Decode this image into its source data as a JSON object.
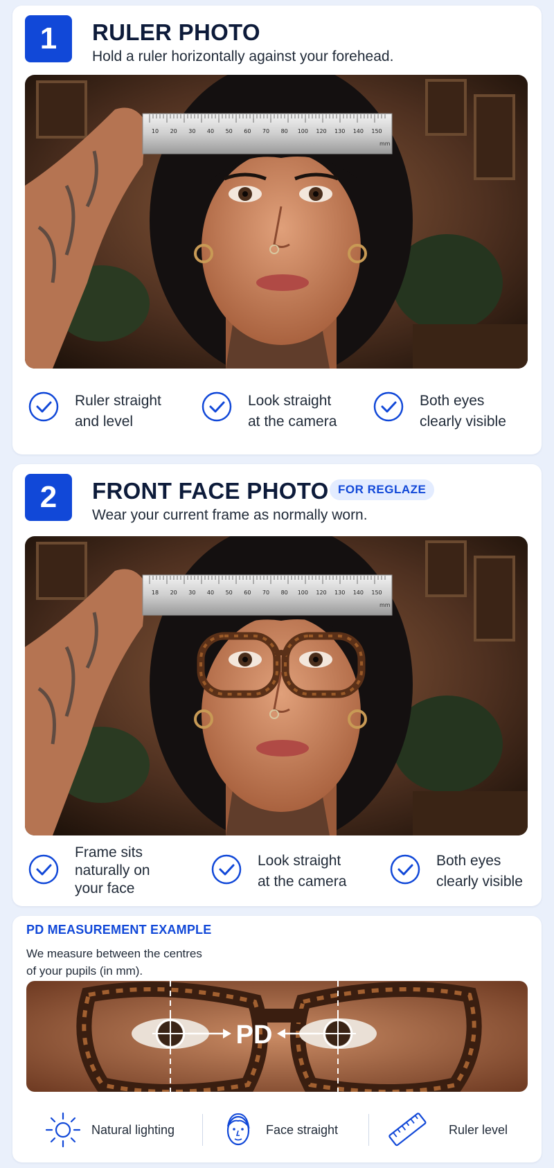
{
  "step1": {
    "number": "1",
    "title": "RULER PHOTO",
    "subtitle": "Hold a ruler horizontally against your forehead.",
    "ruler_ticks": [
      "10",
      "20",
      "30",
      "40",
      "50",
      "60",
      "70",
      "80",
      "100",
      "120",
      "130",
      "140",
      "150"
    ],
    "ruler_unit": "mm",
    "checks": [
      {
        "line1": "Ruler straight",
        "line2": "and level"
      },
      {
        "line1": "Look straight",
        "line2": "at the camera"
      },
      {
        "line1": "Both eyes",
        "line2": "clearly visible"
      }
    ]
  },
  "step2": {
    "number": "2",
    "title": "FRONT FACE PHOTO",
    "badge": "FOR REGLAZE",
    "subtitle": "Wear your current frame as normally worn.",
    "ruler_ticks": [
      "18",
      "20",
      "30",
      "40",
      "50",
      "60",
      "70",
      "80",
      "100",
      "120",
      "130",
      "140",
      "150"
    ],
    "ruler_unit": "mm",
    "checks": [
      {
        "line1": "Frame sits",
        "line2": "naturally on",
        "line3": "your face"
      },
      {
        "line1": "Look straight",
        "line2": "at the camera"
      },
      {
        "line1": "Both eyes",
        "line2": "clearly visible"
      }
    ]
  },
  "pd": {
    "heading": "PD MEASUREMENT EXAMPLE",
    "desc_line1": "We measure between the centres",
    "desc_line2": "of your pupils (in mm).",
    "pd_label": "PD"
  },
  "tips": [
    {
      "label": "Natural lighting",
      "icon": "sun-icon"
    },
    {
      "label": "Face straight",
      "icon": "face-icon"
    },
    {
      "label": "Ruler level",
      "icon": "ruler-icon"
    }
  ],
  "colors": {
    "accent": "#1148d8",
    "page_bg": "#eaf0fb",
    "card_bg": "#ffffff"
  }
}
